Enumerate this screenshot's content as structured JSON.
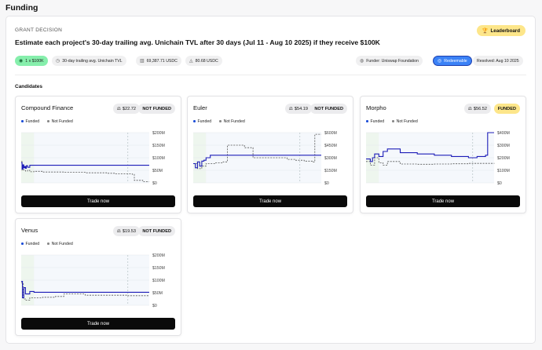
{
  "page": {
    "title": "Funding"
  },
  "decision": {
    "eyebrow": "GRANT DECISION",
    "headline": "Estimate each project's 30-day trailing avg. Unichain TVL after 30 days (Jul 11 - Aug 10 2025) if they receive $100K",
    "leaderboard_label": "Leaderboard",
    "chips": {
      "grant": "1 x $100K",
      "metric": "30-day trailing avg. Unichain TVL",
      "volume": "69,387.71 USDC",
      "liquidity": "80.68 USDC",
      "funder": "Funder: Uniswap Foundation",
      "redeemable": "Redeemable",
      "resolved": "Resolved: Aug 10 2025"
    }
  },
  "candidates_label": "Candidates",
  "legend": {
    "funded": "Funded",
    "not_funded": "Not Funded"
  },
  "trade_label": "Trade now",
  "colors": {
    "funded_line": "#1d1db8",
    "not_funded_line": "#555555",
    "accent_yellow": "#fde68a",
    "accent_blue": "#3b82f6",
    "accent_green": "#86efac"
  },
  "candidates": [
    {
      "name": "Compound Finance",
      "price": "$22.72",
      "status": "NOT FUNDED"
    },
    {
      "name": "Euler",
      "price": "$54.19",
      "status": "NOT FUNDED"
    },
    {
      "name": "Morpho",
      "price": "$56.52",
      "status": "FUNDED"
    },
    {
      "name": "Venus",
      "price": "$19.53",
      "status": "NOT FUNDED"
    }
  ],
  "chart_data": [
    {
      "type": "line",
      "title": "Compound Finance",
      "y_ticks": [
        "$200M",
        "$150M",
        "$100M",
        "$50M",
        "$0"
      ],
      "ylim": [
        0,
        200
      ],
      "xlim": [
        0,
        30
      ],
      "series": [
        {
          "name": "Funded",
          "x": [
            0,
            0.2,
            0.4,
            0.6,
            0.8,
            1,
            1.2,
            1.5,
            2,
            2.5,
            3,
            30
          ],
          "y": [
            80,
            55,
            72,
            60,
            65,
            58,
            68,
            62,
            70,
            70,
            70,
            70
          ]
        },
        {
          "name": "Not Funded",
          "x": [
            0,
            0.2,
            0.5,
            1,
            1.5,
            2,
            3,
            5,
            10,
            15,
            20,
            22,
            26,
            26.5,
            28,
            28.5,
            30
          ],
          "y": [
            85,
            50,
            52,
            47,
            50,
            44,
            46,
            43,
            42,
            40,
            38,
            36,
            34,
            10,
            10,
            5,
            5
          ]
        }
      ]
    },
    {
      "type": "line",
      "title": "Euler",
      "y_ticks": [
        "$600M",
        "$450M",
        "$300M",
        "$150M",
        "$0"
      ],
      "ylim": [
        0,
        600
      ],
      "xlim": [
        0,
        30
      ],
      "series": [
        {
          "name": "Funded",
          "x": [
            0,
            0.5,
            1,
            1.5,
            2,
            2.5,
            3,
            4,
            30
          ],
          "y": [
            230,
            180,
            250,
            200,
            260,
            270,
            300,
            330,
            330
          ]
        },
        {
          "name": "Not Funded",
          "x": [
            0,
            1,
            2,
            3,
            5,
            7,
            8,
            12,
            14,
            22,
            24,
            26,
            28,
            28.5,
            30
          ],
          "y": [
            230,
            170,
            200,
            230,
            240,
            250,
            450,
            420,
            300,
            280,
            270,
            260,
            250,
            580,
            580
          ]
        }
      ]
    },
    {
      "type": "line",
      "title": "Morpho",
      "y_ticks": [
        "$400M",
        "$300M",
        "$200M",
        "$100M",
        "$0"
      ],
      "ylim": [
        0,
        400
      ],
      "xlim": [
        0,
        30
      ],
      "series": [
        {
          "name": "Funded",
          "x": [
            0,
            1,
            1.5,
            2,
            3,
            4,
            5,
            8,
            12,
            16,
            20,
            24,
            26,
            28,
            28.5,
            30
          ],
          "y": [
            190,
            170,
            200,
            230,
            210,
            250,
            270,
            240,
            230,
            220,
            210,
            200,
            210,
            220,
            400,
            400
          ]
        },
        {
          "name": "Not Funded",
          "x": [
            0,
            1,
            2,
            3,
            4,
            5,
            8,
            12,
            16,
            20,
            24,
            30
          ],
          "y": [
            170,
            140,
            200,
            160,
            140,
            170,
            150,
            148,
            150,
            152,
            155,
            158
          ]
        }
      ]
    },
    {
      "type": "line",
      "title": "Venus",
      "y_ticks": [
        "$200M",
        "$150M",
        "$100M",
        "$50M",
        "$0"
      ],
      "ylim": [
        0,
        200
      ],
      "xlim": [
        0,
        30
      ],
      "series": [
        {
          "name": "Funded",
          "x": [
            0,
            0.3,
            0.6,
            1,
            2,
            3,
            30
          ],
          "y": [
            95,
            30,
            70,
            45,
            55,
            52,
            52
          ]
        },
        {
          "name": "Not Funded",
          "x": [
            0,
            0.5,
            1,
            2,
            5,
            8,
            10,
            15,
            20,
            25,
            30
          ],
          "y": [
            90,
            25,
            20,
            30,
            32,
            35,
            45,
            40,
            40,
            38,
            38
          ]
        }
      ]
    }
  ]
}
